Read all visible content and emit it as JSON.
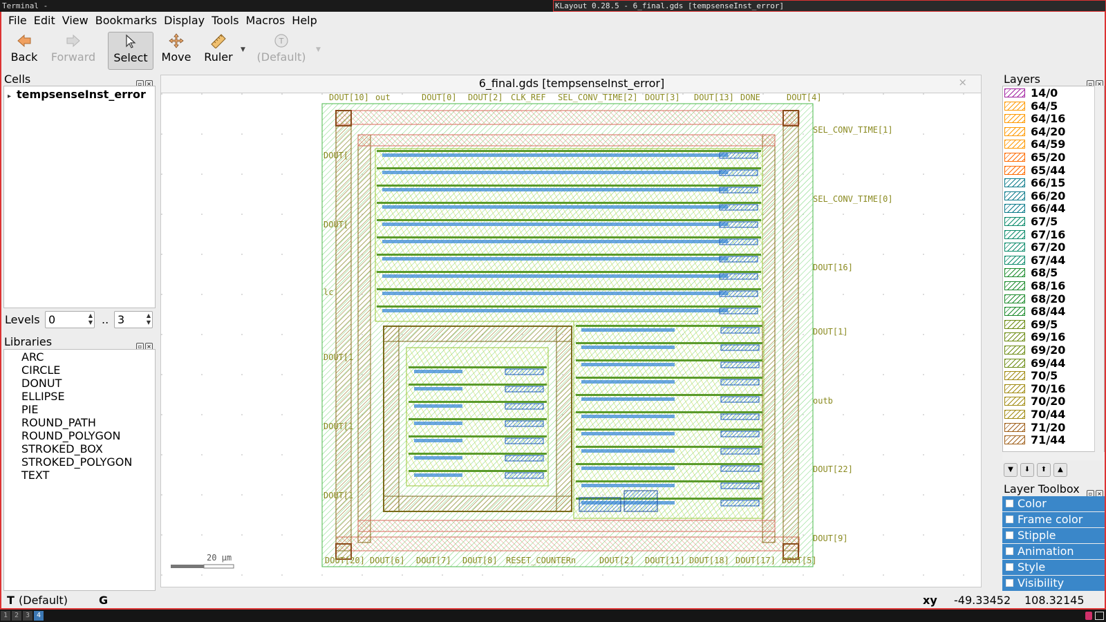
{
  "title_bar": {
    "left": "Terminal -",
    "right": "KLayout 0.28.5 - 6_final.gds [tempsenseInst_error]"
  },
  "menu": [
    "File",
    "Edit",
    "View",
    "Bookmarks",
    "Display",
    "Tools",
    "Macros",
    "Help"
  ],
  "toolbar": {
    "back": "Back",
    "forward": "Forward",
    "select": "Select",
    "move": "Move",
    "ruler": "Ruler",
    "default_template": "(Default)"
  },
  "cells_panel": {
    "title": "Cells",
    "root_cell": "tempsenseInst_error",
    "levels_label": "Levels",
    "levels_from": "0",
    "levels_sep": "..",
    "levels_to": "3"
  },
  "libraries_panel": {
    "title": "Libraries",
    "items": [
      "ARC",
      "CIRCLE",
      "DONUT",
      "ELLIPSE",
      "PIE",
      "ROUND_PATH",
      "ROUND_POLYGON",
      "STROKED_BOX",
      "STROKED_POLYGON",
      "TEXT"
    ]
  },
  "layout_view": {
    "tab_title": "6_final.gds [tempsenseInst_error]",
    "close": "×",
    "pin_labels_top": [
      "DOUT[10]",
      "out",
      "DOUT[0]",
      "DOUT[2]",
      "CLK_REF",
      "SEL_CONV_TIME[2]",
      "DOUT[3]",
      "DOUT[13]",
      "DONE",
      "DOUT[4]"
    ],
    "pin_labels_right": [
      "SEL_CONV_TIME[1]",
      "SEL_CONV_TIME[0]",
      "DOUT[16]",
      "DOUT[1]",
      "outb",
      "DOUT[22]",
      "DOUT[9]"
    ],
    "pin_labels_left": [
      "DOUT[",
      "DOUT[",
      "lc",
      "DOUT[1",
      "DOUT[1",
      "DOUT[1"
    ],
    "pin_labels_bottom": [
      "DOUT[20]",
      "DOUT[6]",
      "DOUT[7]",
      "DOUT[8]",
      "RESET_COUNTERn",
      "DOUT[2]",
      "DOUT[11]",
      "DOUT[18]",
      "DOUT[17]",
      "DOUT[5]"
    ],
    "scale_bar": "20 µm"
  },
  "layers_panel": {
    "title": "Layers",
    "layers": [
      {
        "name": "14/0",
        "color": "#a020a0"
      },
      {
        "name": "64/5",
        "color": "#ff9900"
      },
      {
        "name": "64/16",
        "color": "#ff9900"
      },
      {
        "name": "64/20",
        "color": "#ff9900"
      },
      {
        "name": "64/59",
        "color": "#ff9900"
      },
      {
        "name": "65/20",
        "color": "#ff6a00"
      },
      {
        "name": "65/44",
        "color": "#ff6a00"
      },
      {
        "name": "66/15",
        "color": "#0a7a8a"
      },
      {
        "name": "66/20",
        "color": "#0a7a8a"
      },
      {
        "name": "66/44",
        "color": "#0a7a8a"
      },
      {
        "name": "67/5",
        "color": "#0a8a6a"
      },
      {
        "name": "67/16",
        "color": "#0a8a6a"
      },
      {
        "name": "67/20",
        "color": "#0a8a6a"
      },
      {
        "name": "67/44",
        "color": "#0a8a6a"
      },
      {
        "name": "68/5",
        "color": "#1a8a2a"
      },
      {
        "name": "68/16",
        "color": "#1a8a2a"
      },
      {
        "name": "68/20",
        "color": "#1a8a2a"
      },
      {
        "name": "68/44",
        "color": "#1a8a2a"
      },
      {
        "name": "69/5",
        "color": "#6a8a10"
      },
      {
        "name": "69/16",
        "color": "#6a8a10"
      },
      {
        "name": "69/20",
        "color": "#6a8a10"
      },
      {
        "name": "69/44",
        "color": "#6a8a10"
      },
      {
        "name": "70/5",
        "color": "#a08a10"
      },
      {
        "name": "70/16",
        "color": "#a08a10"
      },
      {
        "name": "70/20",
        "color": "#a08a10"
      },
      {
        "name": "70/44",
        "color": "#a08a10"
      },
      {
        "name": "71/20",
        "color": "#a0601a"
      },
      {
        "name": "71/44",
        "color": "#a0601a"
      }
    ]
  },
  "layer_toolbox": {
    "title": "Layer Toolbox",
    "items": [
      "Color",
      "Frame color",
      "Stipple",
      "Animation",
      "Style",
      "Visibility"
    ]
  },
  "status_bar": {
    "mode_icon": "T",
    "mode": "(Default)",
    "grid_flag": "G",
    "coord_label": "xy",
    "x": "-49.33452",
    "y": "108.32145"
  },
  "workspaces": [
    "1",
    "2",
    "3",
    "4"
  ],
  "icons": {
    "back": "back-arrow-icon",
    "forward": "forward-arrow-icon",
    "select": "cursor-icon",
    "move": "move-cross-icon",
    "ruler": "ruler-icon",
    "template": "text-template-icon"
  }
}
